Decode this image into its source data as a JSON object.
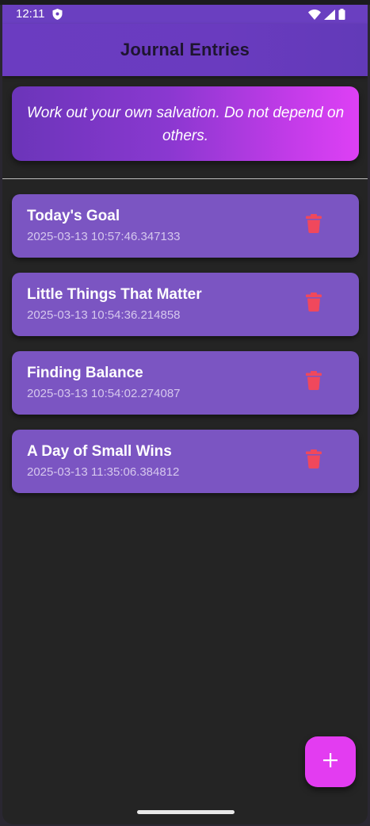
{
  "status_bar": {
    "time": "12:11",
    "icons": [
      "shield-icon",
      "wifi-icon",
      "signal-icon",
      "battery-icon"
    ]
  },
  "app_bar": {
    "title": "Journal Entries"
  },
  "quote": {
    "text": "Work out your own salvation. Do not depend on others."
  },
  "entries": [
    {
      "title": "Today's Goal",
      "date": "2025-03-13 10:57:46.347133"
    },
    {
      "title": "Little Things That Matter",
      "date": "2025-03-13 10:54:36.214858"
    },
    {
      "title": "Finding Balance",
      "date": "2025-03-13 10:54:02.274087"
    },
    {
      "title": "A Day of Small Wins",
      "date": "2025-03-13 11:35:06.384812"
    }
  ],
  "fab": {
    "icon": "plus-icon"
  },
  "colors": {
    "app_bar": "#6a3bbf",
    "card": "#7b55c2",
    "delete": "#f0485c",
    "fab": "#e33cf1",
    "background": "#242424"
  }
}
